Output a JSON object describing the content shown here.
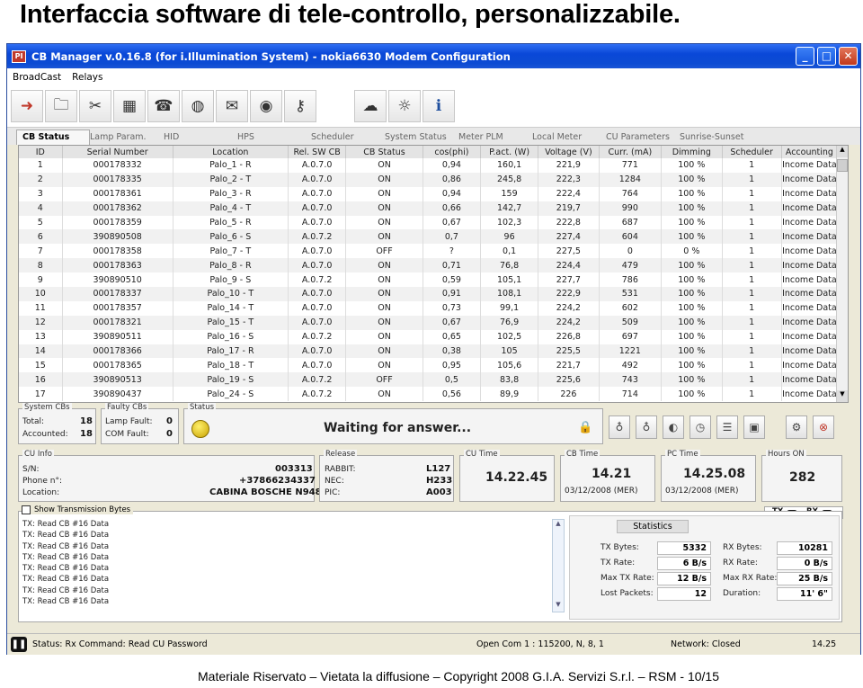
{
  "slide_title": "Interfaccia software di tele-controllo, personalizzabile.",
  "footer": "Materiale Riservato – Vietata la diffusione – Copyright 2008 G.I.A. Servizi S.r.l. – RSM - 10/15",
  "window": {
    "title": "CB Manager v.0.16.8 (for i.Illumination System) - nokia6630 Modem Configuration",
    "menu": [
      "BroadCast",
      "Relays"
    ]
  },
  "tabs": [
    "CB Status",
    "Lamp Param.",
    "HID",
    "HPS",
    "Scheduler",
    "System Status",
    "Meter PLM",
    "Local Meter",
    "CU Parameters",
    "Sunrise-Sunset"
  ],
  "table": {
    "columns": [
      "ID",
      "Serial Number",
      "Location",
      "Rel. SW CB",
      "CB Status",
      "cos(phi)",
      "P.act. (W)",
      "Voltage (V)",
      "Curr. (mA)",
      "Dimming",
      "Scheduler",
      "Accounting"
    ],
    "rows": [
      [
        "1",
        "000178332",
        "Palo_1 - R",
        "A.0.7.0",
        "ON",
        "0,94",
        "160,1",
        "221,9",
        "771",
        "100 %",
        "1",
        "Income Data"
      ],
      [
        "2",
        "000178335",
        "Palo_2 - T",
        "A.0.7.0",
        "ON",
        "0,86",
        "245,8",
        "222,3",
        "1284",
        "100 %",
        "1",
        "Income Data"
      ],
      [
        "3",
        "000178361",
        "Palo_3 - R",
        "A.0.7.0",
        "ON",
        "0,94",
        "159",
        "222,4",
        "764",
        "100 %",
        "1",
        "Income Data"
      ],
      [
        "4",
        "000178362",
        "Palo_4 - T",
        "A.0.7.0",
        "ON",
        "0,66",
        "142,7",
        "219,7",
        "990",
        "100 %",
        "1",
        "Income Data"
      ],
      [
        "5",
        "000178359",
        "Palo_5 - R",
        "A.0.7.0",
        "ON",
        "0,67",
        "102,3",
        "222,8",
        "687",
        "100 %",
        "1",
        "Income Data"
      ],
      [
        "6",
        "390890508",
        "Palo_6 - S",
        "A.0.7.2",
        "ON",
        "0,7",
        "96",
        "227,4",
        "604",
        "100 %",
        "1",
        "Income Data"
      ],
      [
        "7",
        "000178358",
        "Palo_7 - T",
        "A.0.7.0",
        "OFF",
        "?",
        "0,1",
        "227,5",
        "0",
        "0 %",
        "1",
        "Income Data"
      ],
      [
        "8",
        "000178363",
        "Palo_8 - R",
        "A.0.7.0",
        "ON",
        "0,71",
        "76,8",
        "224,4",
        "479",
        "100 %",
        "1",
        "Income Data"
      ],
      [
        "9",
        "390890510",
        "Palo_9 - S",
        "A.0.7.2",
        "ON",
        "0,59",
        "105,1",
        "227,7",
        "786",
        "100 %",
        "1",
        "Income Data"
      ],
      [
        "10",
        "000178337",
        "Palo_10 - T",
        "A.0.7.0",
        "ON",
        "0,91",
        "108,1",
        "222,9",
        "531",
        "100 %",
        "1",
        "Income Data"
      ],
      [
        "11",
        "000178357",
        "Palo_14 - T",
        "A.0.7.0",
        "ON",
        "0,73",
        "99,1",
        "224,2",
        "602",
        "100 %",
        "1",
        "Income Data"
      ],
      [
        "12",
        "000178321",
        "Palo_15 - T",
        "A.0.7.0",
        "ON",
        "0,67",
        "76,9",
        "224,2",
        "509",
        "100 %",
        "1",
        "Income Data"
      ],
      [
        "13",
        "390890511",
        "Palo_16 - S",
        "A.0.7.2",
        "ON",
        "0,65",
        "102,5",
        "226,8",
        "697",
        "100 %",
        "1",
        "Income Data"
      ],
      [
        "14",
        "000178366",
        "Palo_17 - R",
        "A.0.7.0",
        "ON",
        "0,38",
        "105",
        "225,5",
        "1221",
        "100 %",
        "1",
        "Income Data"
      ],
      [
        "15",
        "000178365",
        "Palo_18 - T",
        "A.0.7.0",
        "ON",
        "0,95",
        "105,6",
        "221,7",
        "492",
        "100 %",
        "1",
        "Income Data"
      ],
      [
        "16",
        "390890513",
        "Palo_19 - S",
        "A.0.7.2",
        "OFF",
        "0,5",
        "83,8",
        "225,6",
        "743",
        "100 %",
        "1",
        "Income Data"
      ],
      [
        "17",
        "390890437",
        "Palo_24 - S",
        "A.0.7.2",
        "ON",
        "0,56",
        "89,9",
        "226",
        "714",
        "100 %",
        "1",
        "Income Data"
      ]
    ]
  },
  "system_cbs": {
    "title": "System CBs",
    "total_label": "Total:",
    "total": "18",
    "accounted_label": "Accounted:",
    "accounted": "18"
  },
  "faulty_cbs": {
    "title": "Faulty CBs",
    "lamp_label": "Lamp Fault:",
    "lamp": "0",
    "com_label": "COM Fault:",
    "com": "0"
  },
  "status_box": {
    "title": "Status",
    "text": "Waiting for answer..."
  },
  "cu_info": {
    "title": "CU Info",
    "sn_label": "S/N:",
    "sn": "003313",
    "phone_label": "Phone n°:",
    "phone": "+37866234337",
    "location_label": "Location:",
    "location": "CABINA BOSCHE N948"
  },
  "release": {
    "title": "Release",
    "rabbit_label": "RABBIT:",
    "rabbit": "L127",
    "nec_label": "NEC:",
    "nec": "H233",
    "pic_label": "PIC:",
    "pic": "A003"
  },
  "cu_time": {
    "title": "CU Time",
    "time": "14.22.45"
  },
  "cb_time": {
    "title": "CB Time",
    "time": "14.21",
    "date": "03/12/2008 (MER)"
  },
  "pc_time": {
    "title": "PC Time",
    "time": "14.25.08",
    "date": "03/12/2008 (MER)"
  },
  "hours_on": {
    "title": "Hours ON",
    "value": "282"
  },
  "txrx": {
    "tx": "TX",
    "rx": "RX"
  },
  "transmission": {
    "title": "Show Transmission Bytes",
    "lines": [
      "TX: Read CB #16 Data",
      "TX: Read CB #16 Data",
      "TX: Read CB #16 Data",
      "TX: Read CB #16 Data",
      "TX: Read CB #16 Data",
      "TX: Read CB #16 Data",
      "TX: Read CB #16 Data",
      "TX: Read CB #16 Data"
    ]
  },
  "statistics": {
    "title": "Statistics",
    "tx_bytes_label": "TX Bytes:",
    "tx_bytes": "5332",
    "rx_bytes_label": "RX Bytes:",
    "rx_bytes": "10281",
    "tx_rate_label": "TX Rate:",
    "tx_rate": "6 B/s",
    "rx_rate_label": "RX Rate:",
    "rx_rate": "0 B/s",
    "max_tx_label": "Max TX Rate:",
    "max_tx": "12 B/s",
    "max_rx_label": "Max RX Rate:",
    "max_rx": "25 B/s",
    "lost_label": "Lost Packets:",
    "lost": "12",
    "duration_label": "Duration:",
    "duration": "11' 6\""
  },
  "statusbar": {
    "status": "Status: Rx Command: Read CU Password",
    "port": "Open Com 1 : 115200, N, 8, 1",
    "network": "Network: Closed",
    "time": "14.25"
  }
}
